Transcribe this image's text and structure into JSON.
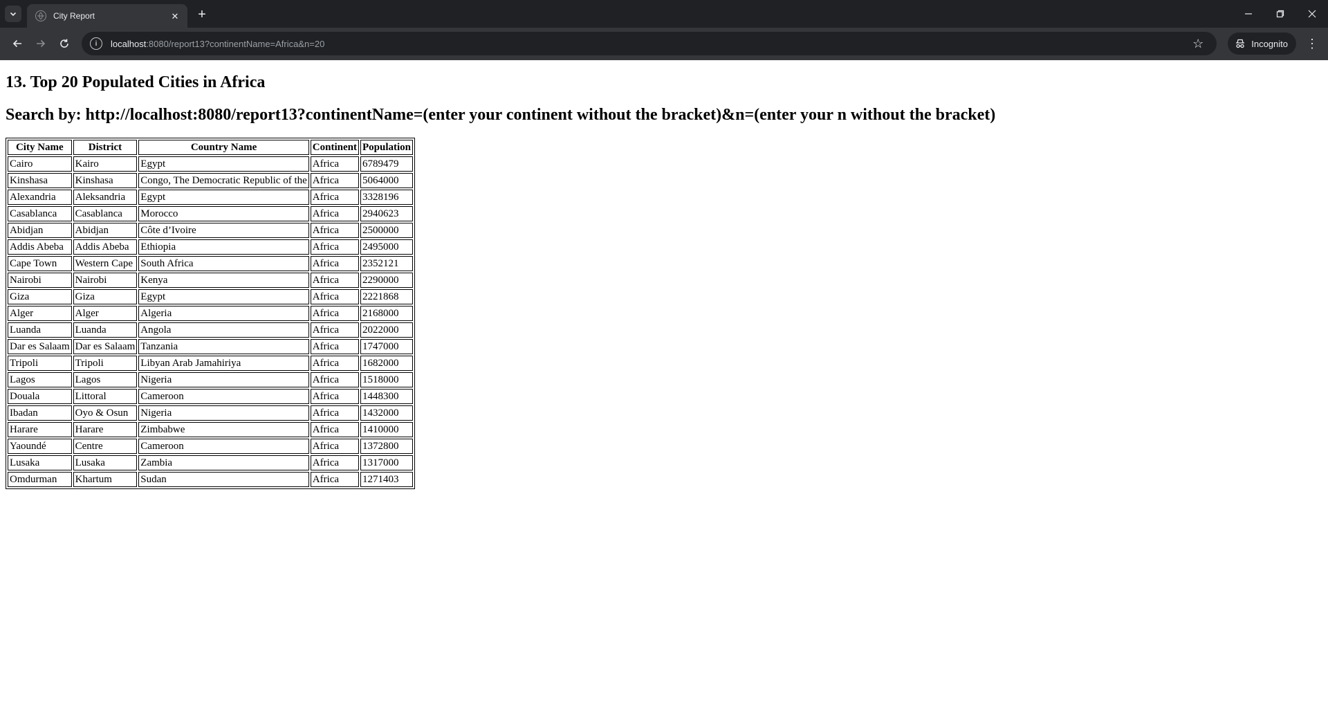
{
  "browser": {
    "tab_title": "City Report",
    "url_host": "localhost",
    "url_rest": ":8080/report13?continentName=Africa&n=20",
    "incognito_label": "Incognito",
    "window_controls": [
      "minimize-icon",
      "restore-icon",
      "close-icon"
    ]
  },
  "page": {
    "title": "13. Top 20 Populated Cities in Africa",
    "search_hint": "Search by: http://localhost:8080/report13?continentName=(enter your continent without the bracket)&n=(enter your n without the bracket)"
  },
  "table": {
    "headers": [
      "City Name",
      "District",
      "Country Name",
      "Continent",
      "Population"
    ],
    "rows": [
      [
        "Cairo",
        "Kairo",
        "Egypt",
        "Africa",
        "6789479"
      ],
      [
        "Kinshasa",
        "Kinshasa",
        "Congo, The Democratic Republic of the",
        "Africa",
        "5064000"
      ],
      [
        "Alexandria",
        "Aleksandria",
        "Egypt",
        "Africa",
        "3328196"
      ],
      [
        "Casablanca",
        "Casablanca",
        "Morocco",
        "Africa",
        "2940623"
      ],
      [
        "Abidjan",
        "Abidjan",
        "Côte d’Ivoire",
        "Africa",
        "2500000"
      ],
      [
        "Addis Abeba",
        "Addis Abeba",
        "Ethiopia",
        "Africa",
        "2495000"
      ],
      [
        "Cape Town",
        "Western Cape",
        "South Africa",
        "Africa",
        "2352121"
      ],
      [
        "Nairobi",
        "Nairobi",
        "Kenya",
        "Africa",
        "2290000"
      ],
      [
        "Giza",
        "Giza",
        "Egypt",
        "Africa",
        "2221868"
      ],
      [
        "Alger",
        "Alger",
        "Algeria",
        "Africa",
        "2168000"
      ],
      [
        "Luanda",
        "Luanda",
        "Angola",
        "Africa",
        "2022000"
      ],
      [
        "Dar es Salaam",
        "Dar es Salaam",
        "Tanzania",
        "Africa",
        "1747000"
      ],
      [
        "Tripoli",
        "Tripoli",
        "Libyan Arab Jamahiriya",
        "Africa",
        "1682000"
      ],
      [
        "Lagos",
        "Lagos",
        "Nigeria",
        "Africa",
        "1518000"
      ],
      [
        "Douala",
        "Littoral",
        "Cameroon",
        "Africa",
        "1448300"
      ],
      [
        "Ibadan",
        "Oyo & Osun",
        "Nigeria",
        "Africa",
        "1432000"
      ],
      [
        "Harare",
        "Harare",
        "Zimbabwe",
        "Africa",
        "1410000"
      ],
      [
        "Yaoundé",
        "Centre",
        "Cameroon",
        "Africa",
        "1372800"
      ],
      [
        "Lusaka",
        "Lusaka",
        "Zambia",
        "Africa",
        "1317000"
      ],
      [
        "Omdurman",
        "Khartum",
        "Sudan",
        "Africa",
        "1271403"
      ]
    ]
  }
}
